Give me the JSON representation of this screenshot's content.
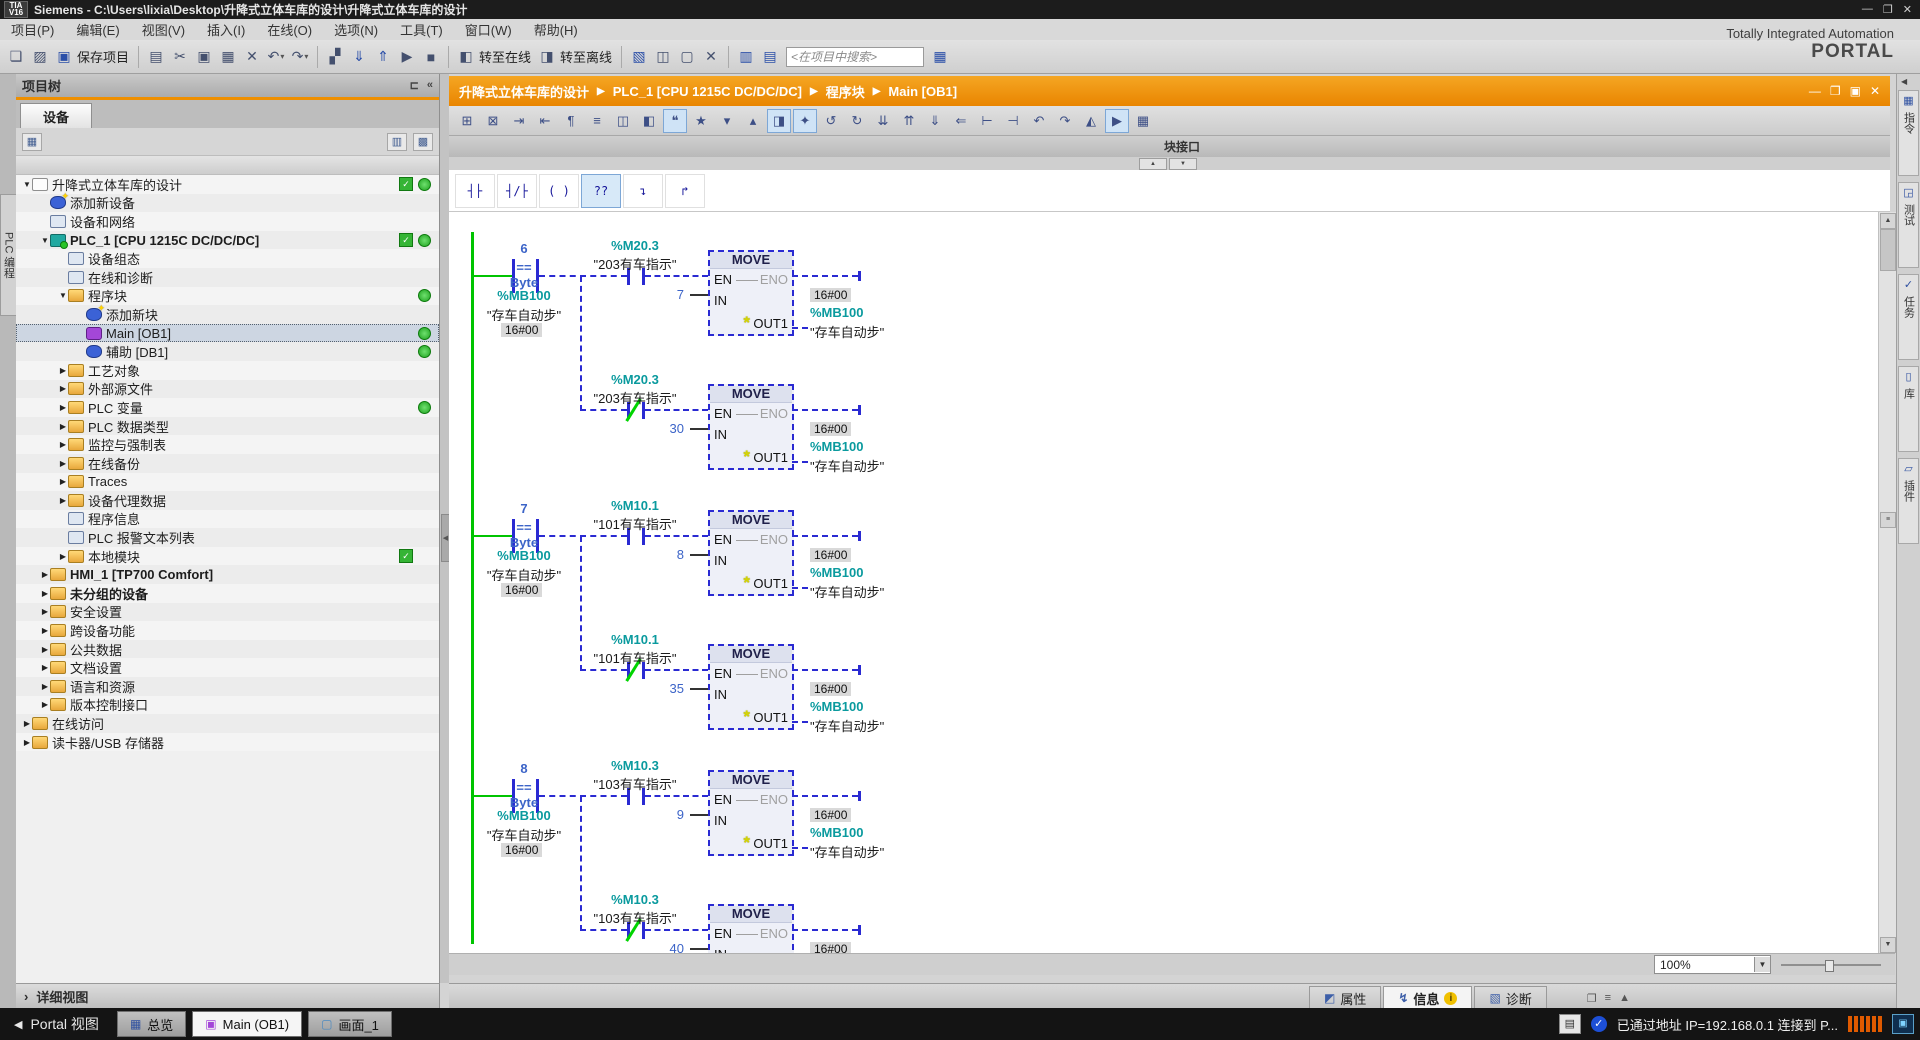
{
  "window": {
    "logo": "TIA\nV16",
    "title": "Siemens  -  C:\\Users\\lixia\\Desktop\\升降式立体车库的设计\\升降式立体车库的设计",
    "controls": [
      "—",
      "❐",
      "✕"
    ]
  },
  "menu": {
    "items": [
      "项目(P)",
      "编辑(E)",
      "视图(V)",
      "插入(I)",
      "在线(O)",
      "选项(N)",
      "工具(T)",
      "窗口(W)",
      "帮助(H)"
    ]
  },
  "toolbar": {
    "save_label": "保存项目",
    "go_online_label": "转至在线",
    "go_offline_label": "转至离线",
    "search_placeholder": "<在项目中搜索>",
    "items": [
      {
        "t": "icon",
        "n": "new-project-icon",
        "g": "❏"
      },
      {
        "t": "icon",
        "n": "open-project-icon",
        "g": "▨"
      },
      {
        "t": "iconlabel",
        "n": "save-project-button",
        "g": "▣",
        "labelKey": "save_label",
        "c": "blue"
      },
      {
        "t": "sep"
      },
      {
        "t": "icon",
        "n": "print-icon",
        "g": "▤"
      },
      {
        "t": "icon",
        "n": "cut-icon",
        "g": "✂"
      },
      {
        "t": "icon",
        "n": "copy-icon",
        "g": "▣"
      },
      {
        "t": "icon",
        "n": "paste-icon",
        "g": "▦"
      },
      {
        "t": "icon",
        "n": "delete-icon",
        "g": "✕"
      },
      {
        "t": "icondd",
        "n": "undo-button",
        "g": "↶"
      },
      {
        "t": "icondd",
        "n": "redo-button",
        "g": "↷"
      },
      {
        "t": "sep"
      },
      {
        "t": "icon",
        "n": "compile-icon",
        "g": "▞"
      },
      {
        "t": "icon",
        "n": "download-to-device-icon",
        "g": "⇓",
        "c": "blue"
      },
      {
        "t": "icon",
        "n": "upload-from-device-icon",
        "g": "⇑",
        "c": "blue"
      },
      {
        "t": "icon",
        "n": "start-cpu-icon",
        "g": "▶"
      },
      {
        "t": "icon",
        "n": "stop-cpu-icon",
        "g": "■"
      },
      {
        "t": "sep"
      },
      {
        "t": "iconlabel",
        "n": "go-online-button",
        "g": "◧",
        "labelKey": "go_online_label"
      },
      {
        "t": "iconlabel",
        "n": "go-offline-button",
        "g": "◨",
        "labelKey": "go_offline_label"
      },
      {
        "t": "sep"
      },
      {
        "t": "icon",
        "n": "accessible-devices-icon",
        "g": "▧",
        "c": "blue"
      },
      {
        "t": "icon",
        "n": "start-simulation-icon",
        "g": "◫"
      },
      {
        "t": "icon",
        "n": "restore-window-icon",
        "g": "▢"
      },
      {
        "t": "icon",
        "n": "cross-reference-icon",
        "g": "✕"
      },
      {
        "t": "sep"
      },
      {
        "t": "icon",
        "n": "split-horizontal-icon",
        "g": "▥",
        "c": "blue"
      },
      {
        "t": "icon",
        "n": "split-vertical-icon",
        "g": "▤",
        "c": "blue"
      },
      {
        "t": "search"
      },
      {
        "t": "icon",
        "n": "library-view-icon",
        "g": "▦",
        "c": "blue"
      }
    ]
  },
  "brand": {
    "line1": "Totally Integrated Automation",
    "line2": "PORTAL"
  },
  "left_panel_tab": "PLC 编程",
  "project_tree": {
    "title": "项目树",
    "header_icons": [
      "⊏",
      "«"
    ],
    "tab_devices": "设备",
    "detail_view": "详细视图",
    "detail_arrow": "›",
    "items": [
      {
        "label": "升降式立体车库的设计",
        "level": 0,
        "arrow": "▼",
        "icon": "project",
        "check": true,
        "dot": true
      },
      {
        "label": "添加新设备",
        "level": 1,
        "arrow": "",
        "icon": "add"
      },
      {
        "label": "设备和网络",
        "level": 1,
        "arrow": "",
        "icon": "network"
      },
      {
        "label": "PLC_1 [CPU 1215C DC/DC/DC]",
        "level": 1,
        "arrow": "▼",
        "icon": "plc",
        "check": true,
        "dot": true,
        "bold": true
      },
      {
        "label": "设备组态",
        "level": 2,
        "arrow": "",
        "icon": "config"
      },
      {
        "label": "在线和诊断",
        "level": 2,
        "arrow": "",
        "icon": "diag"
      },
      {
        "label": "程序块",
        "level": 2,
        "arrow": "▼",
        "icon": "folder-block",
        "dot": true
      },
      {
        "label": "添加新块",
        "level": 3,
        "arrow": "",
        "icon": "add"
      },
      {
        "label": "Main [OB1]",
        "level": 3,
        "arrow": "",
        "icon": "ob",
        "dot": true,
        "selected": true
      },
      {
        "label": "辅助 [DB1]",
        "level": 3,
        "arrow": "",
        "icon": "db",
        "dot": true
      },
      {
        "label": "工艺对象",
        "level": 2,
        "arrow": "▶",
        "icon": "folder-tech"
      },
      {
        "label": "外部源文件",
        "level": 2,
        "arrow": "▶",
        "icon": "folder-src"
      },
      {
        "label": "PLC 变量",
        "level": 2,
        "arrow": "▶",
        "icon": "folder-tag",
        "dot": true
      },
      {
        "label": "PLC 数据类型",
        "level": 2,
        "arrow": "▶",
        "icon": "folder-type"
      },
      {
        "label": "监控与强制表",
        "level": 2,
        "arrow": "▶",
        "icon": "folder-watch"
      },
      {
        "label": "在线备份",
        "level": 2,
        "arrow": "▶",
        "icon": "folder-backup"
      },
      {
        "label": "Traces",
        "level": 2,
        "arrow": "▶",
        "icon": "folder-trace"
      },
      {
        "label": "设备代理数据",
        "level": 2,
        "arrow": "▶",
        "icon": "folder-proxy"
      },
      {
        "label": "程序信息",
        "level": 2,
        "arrow": "",
        "icon": "info"
      },
      {
        "label": "PLC 报警文本列表",
        "level": 2,
        "arrow": "",
        "icon": "alarm"
      },
      {
        "label": "本地模块",
        "level": 2,
        "arrow": "▶",
        "icon": "folder-module",
        "check": true
      },
      {
        "label": "HMI_1 [TP700 Comfort]",
        "level": 1,
        "arrow": "▶",
        "icon": "hmi",
        "bold": true
      },
      {
        "label": "未分组的设备",
        "level": 1,
        "arrow": "▶",
        "icon": "ungrouped",
        "bold": true
      },
      {
        "label": "安全设置",
        "level": 1,
        "arrow": "▶",
        "icon": "security"
      },
      {
        "label": "跨设备功能",
        "level": 1,
        "arrow": "▶",
        "icon": "crossdev"
      },
      {
        "label": "公共数据",
        "level": 1,
        "arrow": "▶",
        "icon": "common"
      },
      {
        "label": "文档设置",
        "level": 1,
        "arrow": "▶",
        "icon": "docset"
      },
      {
        "label": "语言和资源",
        "level": 1,
        "arrow": "▶",
        "icon": "lang"
      },
      {
        "label": "版本控制接口",
        "level": 1,
        "arrow": "▶",
        "icon": "version"
      },
      {
        "label": "在线访问",
        "level": 0,
        "arrow": "▶",
        "icon": "online-access"
      },
      {
        "label": "读卡器/USB 存储器",
        "level": 0,
        "arrow": "▶",
        "icon": "card-reader"
      }
    ]
  },
  "breadcrumb": {
    "segments": [
      "升降式立体车库的设计",
      "PLC_1 [CPU 1215C DC/DC/DC]",
      "程序块",
      "Main [OB1]"
    ],
    "window_icons": [
      "—",
      "❐",
      "▣",
      "✕"
    ]
  },
  "editor": {
    "block_interface": "块接口",
    "toolbar_icons": [
      {
        "n": "insert-network-icon",
        "g": "⊞"
      },
      {
        "n": "delete-network-icon",
        "g": "⊠"
      },
      {
        "n": "goto-next-error-icon",
        "g": "⇥"
      },
      {
        "n": "goto-previous-error-icon",
        "g": "⇤"
      },
      {
        "n": "keep-call-options-icon",
        "g": "¶"
      },
      {
        "n": "network-sequence-icon",
        "g": "≡"
      },
      {
        "n": "expand-all-networks-icon",
        "g": "◫"
      },
      {
        "n": "collapse-all-networks-icon",
        "g": "◧"
      },
      {
        "n": "network-comments-icon",
        "g": "❝",
        "hl": true
      },
      {
        "n": "show-favorites-icon",
        "g": "★"
      },
      {
        "n": "show-absolute-operands-icon",
        "g": "▾"
      },
      {
        "n": "hide-absolute-operands-icon",
        "g": "▴"
      },
      {
        "n": "symbol-information-icon",
        "g": "◨",
        "hl": true
      },
      {
        "n": "edit-favorites-icon",
        "g": "✦",
        "hl": true
      },
      {
        "n": "open-branch-icon",
        "g": "↺"
      },
      {
        "n": "close-branch-icon",
        "g": "↻"
      },
      {
        "n": "insert-row-icon",
        "g": "⇊"
      },
      {
        "n": "delete-row-icon",
        "g": "⇈"
      },
      {
        "n": "update-block-call-icon",
        "g": "⇓"
      },
      {
        "n": "unwind-call-icon",
        "g": "⇐"
      },
      {
        "n": "consistency-check-icon",
        "g": "⊢"
      },
      {
        "n": "free-form-comment-icon",
        "g": "⊣"
      },
      {
        "n": "undo-network-icon",
        "g": "↶"
      },
      {
        "n": "redo-network-icon",
        "g": "↷"
      },
      {
        "n": "go-online-small-icon",
        "g": "◭"
      },
      {
        "n": "monitoring-on-off-icon",
        "g": "▶",
        "hl": true
      },
      {
        "n": "call-environment-icon",
        "g": "▦"
      }
    ],
    "favorites": [
      {
        "n": "no-contact-fav-icon",
        "g": "┤├"
      },
      {
        "n": "nc-contact-fav-icon",
        "g": "┤/├"
      },
      {
        "n": "coil-fav-icon",
        "g": "( )"
      },
      {
        "n": "empty-box-fav-icon",
        "g": "??",
        "hl": true
      },
      {
        "n": "open-branch-fav-icon",
        "g": "↴"
      },
      {
        "n": "close-branch-fav-icon",
        "g": "↱"
      }
    ],
    "zoom_value": "100%"
  },
  "lad": {
    "common": {
      "cmp_op": "==",
      "cmp_type": "Byte",
      "operand": "%MB100",
      "operand_comment": "\"存车自动步\"",
      "hex_value": "16#00",
      "move_title": "MOVE",
      "en": "EN",
      "eno": "ENO",
      "in": "IN",
      "out": "OUT1",
      "out_value": "16#00"
    },
    "networks": [
      {
        "step": "6",
        "contact_addr": "%M20.3",
        "contact_comment": "\"203有车指示\"",
        "in_no": "7",
        "in_nc": "30"
      },
      {
        "step": "7",
        "contact_addr": "%M10.1",
        "contact_comment": "\"101有车指示\"",
        "in_no": "8",
        "in_nc": "35"
      },
      {
        "step": "8",
        "contact_addr": "%M10.3",
        "contact_comment": "\"103有车指示\"",
        "in_no": "9",
        "in_nc": "40"
      }
    ]
  },
  "inspector": {
    "tabs": [
      {
        "label": "属性",
        "icon": "properties-icon",
        "g": "◩"
      },
      {
        "label": "信息",
        "icon": "info-icon",
        "g": "↯",
        "active": true,
        "badge": "i"
      },
      {
        "label": "诊断",
        "icon": "diagnostics-icon",
        "g": "▧"
      }
    ],
    "window_icons": [
      "❐",
      "≡",
      "▲"
    ]
  },
  "right_panel": {
    "collapse_arrow": "◀",
    "tabs": [
      {
        "label": "指令",
        "icon": "instructions-icon",
        "g": "▦"
      },
      {
        "label": "测试",
        "icon": "testing-icon",
        "g": "◲"
      },
      {
        "label": "任务",
        "icon": "tasks-icon",
        "g": "✓"
      },
      {
        "label": "库",
        "icon": "libraries-icon",
        "g": "▯"
      },
      {
        "label": "插件",
        "icon": "addins-icon",
        "g": "▱"
      }
    ]
  },
  "taskbar": {
    "portal_view": "Portal 视图",
    "portal_arrow": "◀",
    "buttons": [
      {
        "label": "总览",
        "icon": "overview-icon",
        "g": "▦",
        "c": "#2d4fa0"
      },
      {
        "label": "Main (OB1)",
        "icon": "main-ob1-icon",
        "g": "▣",
        "c": "#a447d8",
        "active": true
      },
      {
        "label": "画面_1",
        "icon": "screen-icon",
        "g": "▢",
        "c": "#4d8ac0"
      }
    ],
    "status_text": "已通过地址 IP=192.168.0.1 连接到 P...",
    "status_check": "✓"
  },
  "colors": {
    "accent_orange": "#ee8f00",
    "wire_blue": "#2a2ad2",
    "rail_green": "#00c400",
    "operand_teal": "#0a9a9e",
    "value_blue": "#3c64c8",
    "selection": "#cdd6e2"
  }
}
